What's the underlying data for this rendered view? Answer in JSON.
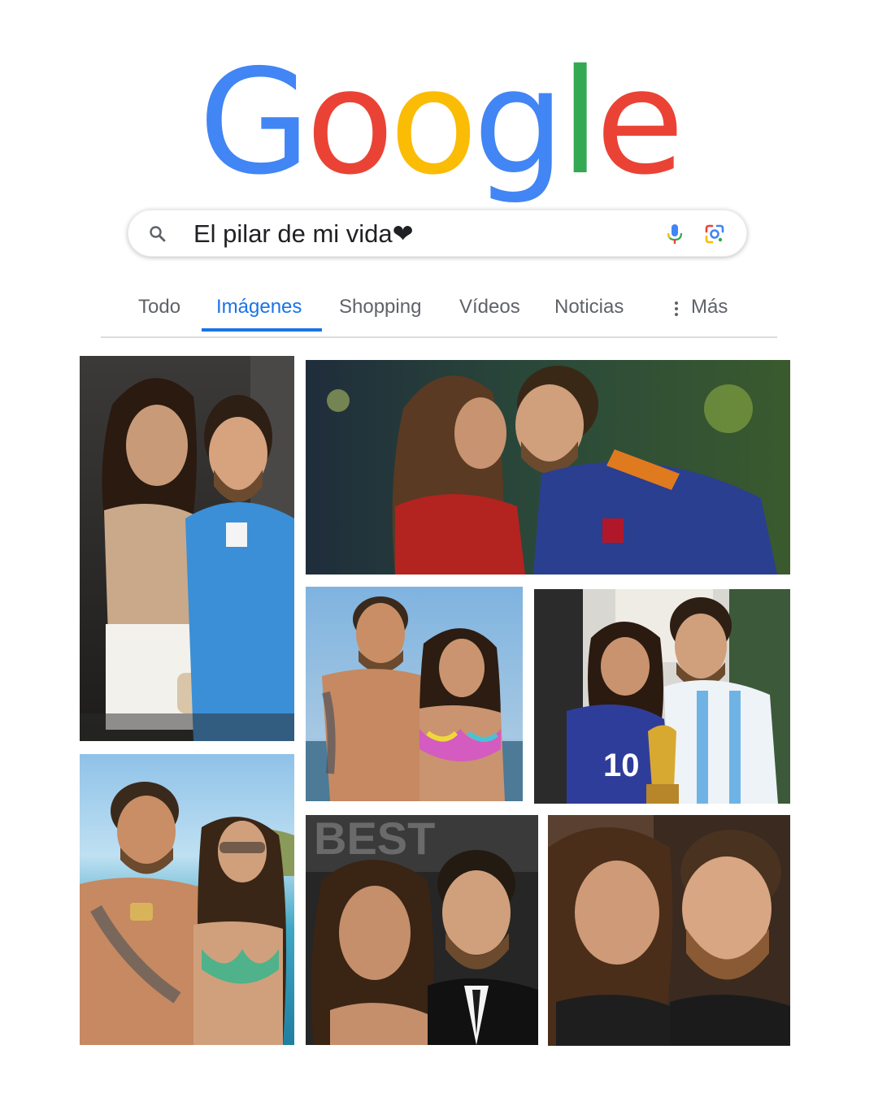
{
  "logo": {
    "letters": [
      "G",
      "o",
      "o",
      "g",
      "l",
      "e"
    ],
    "colors": [
      "#4285F4",
      "#EA4335",
      "#FBBC05",
      "#4285F4",
      "#34A853",
      "#EA4335"
    ]
  },
  "search": {
    "query": "El pilar de mi vida❤",
    "icon": "search-icon",
    "voice_icon": "microphone-icon",
    "lens_icon": "google-lens-icon"
  },
  "tabs": [
    {
      "label": "Todo",
      "active": false
    },
    {
      "label": "Imágenes",
      "active": true
    },
    {
      "label": "Shopping",
      "active": false
    },
    {
      "label": "Vídeos",
      "active": false
    },
    {
      "label": "Noticias",
      "active": false
    },
    {
      "label": "Más",
      "active": false,
      "icon": "more-vert-icon"
    }
  ],
  "image_results": [
    {
      "subject": "couple-portrait-evening"
    },
    {
      "subject": "couple-kiss-stadium"
    },
    {
      "subject": "couple-beach-sunset"
    },
    {
      "subject": "couple-with-trophy"
    },
    {
      "subject": "couple-boat-sea"
    },
    {
      "subject": "couple-awards-event"
    },
    {
      "subject": "couple-closeup-smile"
    }
  ],
  "colors": {
    "accent": "#1a73e8",
    "tab_text": "#5f6368",
    "query_text": "#202124"
  }
}
